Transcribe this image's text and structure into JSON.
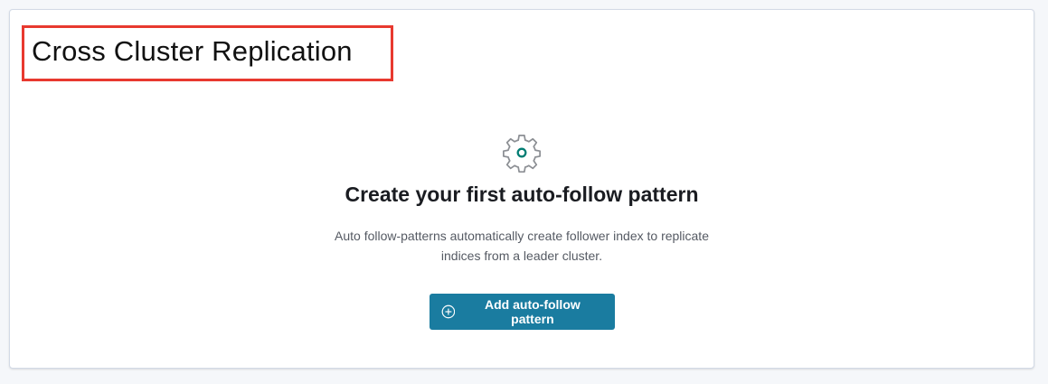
{
  "header": {
    "title": "Cross Cluster Replication"
  },
  "empty_state": {
    "icon": "gear-icon",
    "title": "Create your first auto-follow pattern",
    "description": "Auto follow-patterns automatically create follower index to replicate indices from a leader cluster.",
    "button": {
      "label": "Add auto-follow pattern",
      "icon": "plus-circle-icon"
    }
  },
  "colors": {
    "accent": "#1a7ca0",
    "highlight_border": "#e8392f",
    "gear_stroke": "#8c8f94",
    "gear_center": "#017d73"
  }
}
